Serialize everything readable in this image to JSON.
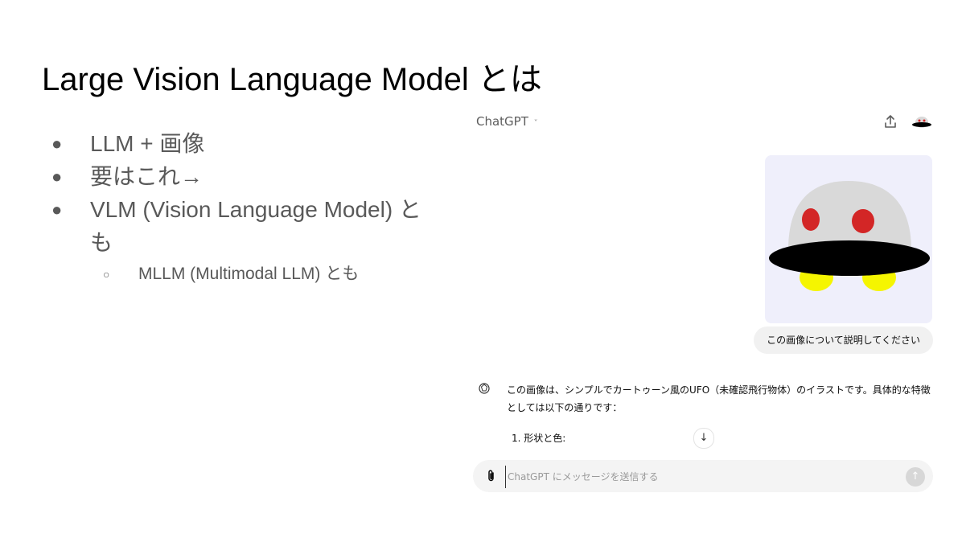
{
  "slide": {
    "title": "Large Vision Language Model とは",
    "bullets": [
      {
        "marker": "●",
        "text": "LLM + 画像"
      },
      {
        "marker": "●",
        "text": "要はこれ→"
      },
      {
        "marker": "●",
        "text": "VLM (Vision Language Model) とも"
      }
    ],
    "sub_bullets": [
      {
        "marker": "○",
        "text": "MLLM (Multimodal LLM) とも"
      }
    ]
  },
  "chat": {
    "model_selector_label": "ChatGPT",
    "model_selector_chevron": "˅",
    "share_icon": "share-icon",
    "avatar_icon": "ufo-avatar",
    "user_image_icon": "ufo-illustration",
    "user_message": "この画像について説明してください",
    "assistant_icon": "openai-logo-icon",
    "assistant_response": "この画像は、シンプルでカートゥーン風のUFO（未確認飛行物体）のイラストです。具体的な特徴としては以下の通りです：",
    "assistant_list_items": [
      "1.  形状と色:"
    ],
    "scroll_down_glyph": "↓",
    "composer_placeholder": "ChatGPT にメッセージを送信する",
    "send_glyph": "↑",
    "colors": {
      "ufo_dome": "#d9d9d9",
      "ufo_eyes": "#d32626",
      "ufo_disc": "#000000",
      "ufo_lights": "#f5f500",
      "image_bg": "#efeffb"
    }
  }
}
